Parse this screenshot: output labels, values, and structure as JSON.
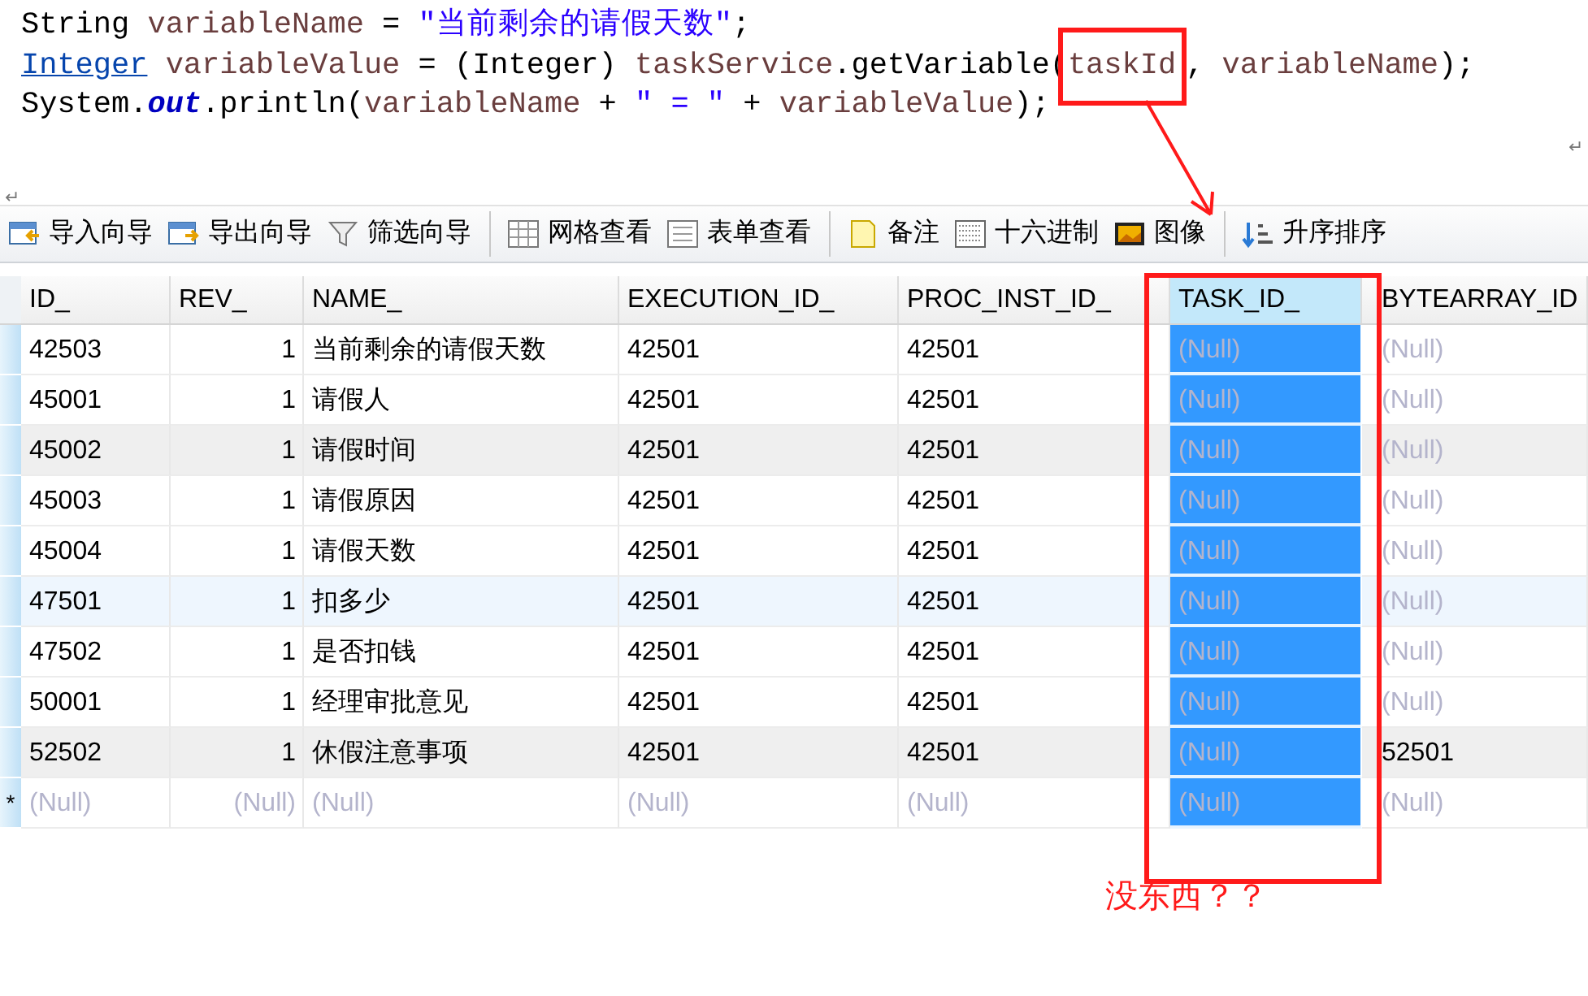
{
  "code_lines": [
    [
      {
        "text": "String ",
        "kind": "plain"
      },
      {
        "text": "variableName",
        "kind": "var"
      },
      {
        "text": " = ",
        "kind": "plain"
      },
      {
        "text": "\"当前剩余的请假天数\"",
        "kind": "string"
      },
      {
        "text": ";",
        "kind": "plain"
      }
    ],
    [
      {
        "text": "Integer",
        "kind": "link"
      },
      {
        "text": " variableValue",
        "kind": "var"
      },
      {
        "text": " = (Integer) ",
        "kind": "plain"
      },
      {
        "text": "taskService",
        "kind": "var"
      },
      {
        "text": ".getVariable(",
        "kind": "plain"
      },
      {
        "text": "taskId",
        "kind": "boxed"
      },
      {
        "text": ", ",
        "kind": "plain"
      },
      {
        "text": "variableName",
        "kind": "var"
      },
      {
        "text": ");",
        "kind": "plain"
      }
    ],
    [
      {
        "text": "System.",
        "kind": "plain"
      },
      {
        "text": "out",
        "kind": "field"
      },
      {
        "text": ".println(",
        "kind": "plain"
      },
      {
        "text": "variableName",
        "kind": "var"
      },
      {
        "text": " + ",
        "kind": "plain"
      },
      {
        "text": "\" = \"",
        "kind": "string"
      },
      {
        "text": " + ",
        "kind": "plain"
      },
      {
        "text": "variableValue",
        "kind": "var"
      },
      {
        "text": ");",
        "kind": "plain"
      }
    ]
  ],
  "paragraph_marks": [
    "↵",
    "↵"
  ],
  "toolbar": [
    {
      "label": "导入向导",
      "kind": "import"
    },
    {
      "label": "导出向导",
      "kind": "export"
    },
    {
      "label": "筛选向导",
      "kind": "filter",
      "separator_after": true
    },
    {
      "label": "网格查看",
      "kind": "grid"
    },
    {
      "label": "表单查看",
      "kind": "form",
      "separator_after": true
    },
    {
      "label": "备注",
      "kind": "note"
    },
    {
      "label": "十六进制",
      "kind": "hex"
    },
    {
      "label": "图像",
      "kind": "image",
      "separator_after": true
    },
    {
      "label": "升序排序",
      "kind": "sort"
    }
  ],
  "table": {
    "columns": [
      {
        "label": "ID_",
        "selected": false
      },
      {
        "label": "REV_",
        "selected": false
      },
      {
        "label": "NAME_",
        "selected": false
      },
      {
        "label": "EXECUTION_ID_",
        "selected": false
      },
      {
        "label": "PROC_INST_ID_",
        "selected": false
      },
      {
        "label": "TASK_ID_",
        "selected": true
      },
      {
        "label": "BYTEARRAY_ID",
        "selected": false
      }
    ],
    "rows": [
      {
        "striped": false,
        "hovered": false,
        "cells": [
          {
            "text": "42503",
            "null": false
          },
          {
            "text": "1",
            "null": false
          },
          {
            "text": "当前剩余的请假天数",
            "null": false
          },
          {
            "text": "42501",
            "null": false
          },
          {
            "text": "42501",
            "null": false
          },
          {
            "text": "(Null)",
            "null": true
          },
          {
            "text": "(Null)",
            "null": true
          }
        ]
      },
      {
        "striped": false,
        "hovered": false,
        "cells": [
          {
            "text": "45001",
            "null": false
          },
          {
            "text": "1",
            "null": false
          },
          {
            "text": "请假人",
            "null": false
          },
          {
            "text": "42501",
            "null": false
          },
          {
            "text": "42501",
            "null": false
          },
          {
            "text": "(Null)",
            "null": true
          },
          {
            "text": "(Null)",
            "null": true
          }
        ]
      },
      {
        "striped": true,
        "hovered": false,
        "cells": [
          {
            "text": "45002",
            "null": false
          },
          {
            "text": "1",
            "null": false
          },
          {
            "text": "请假时间",
            "null": false
          },
          {
            "text": "42501",
            "null": false
          },
          {
            "text": "42501",
            "null": false
          },
          {
            "text": "(Null)",
            "null": true
          },
          {
            "text": "(Null)",
            "null": true
          }
        ]
      },
      {
        "striped": false,
        "hovered": false,
        "cells": [
          {
            "text": "45003",
            "null": false
          },
          {
            "text": "1",
            "null": false
          },
          {
            "text": "请假原因",
            "null": false
          },
          {
            "text": "42501",
            "null": false
          },
          {
            "text": "42501",
            "null": false
          },
          {
            "text": "(Null)",
            "null": true
          },
          {
            "text": "(Null)",
            "null": true
          }
        ]
      },
      {
        "striped": false,
        "hovered": false,
        "cells": [
          {
            "text": "45004",
            "null": false
          },
          {
            "text": "1",
            "null": false
          },
          {
            "text": "请假天数",
            "null": false
          },
          {
            "text": "42501",
            "null": false
          },
          {
            "text": "42501",
            "null": false
          },
          {
            "text": "(Null)",
            "null": true
          },
          {
            "text": "(Null)",
            "null": true
          }
        ]
      },
      {
        "striped": false,
        "hovered": true,
        "cells": [
          {
            "text": "47501",
            "null": false
          },
          {
            "text": "1",
            "null": false
          },
          {
            "text": "扣多少",
            "null": false
          },
          {
            "text": "42501",
            "null": false
          },
          {
            "text": "42501",
            "null": false
          },
          {
            "text": "(Null)",
            "null": true
          },
          {
            "text": "(Null)",
            "null": true
          }
        ]
      },
      {
        "striped": false,
        "hovered": false,
        "cells": [
          {
            "text": "47502",
            "null": false
          },
          {
            "text": "1",
            "null": false
          },
          {
            "text": "是否扣钱",
            "null": false
          },
          {
            "text": "42501",
            "null": false
          },
          {
            "text": "42501",
            "null": false
          },
          {
            "text": "(Null)",
            "null": true
          },
          {
            "text": "(Null)",
            "null": true
          }
        ]
      },
      {
        "striped": false,
        "hovered": false,
        "cells": [
          {
            "text": "50001",
            "null": false
          },
          {
            "text": "1",
            "null": false
          },
          {
            "text": "经理审批意见",
            "null": false
          },
          {
            "text": "42501",
            "null": false
          },
          {
            "text": "42501",
            "null": false
          },
          {
            "text": "(Null)",
            "null": true
          },
          {
            "text": "(Null)",
            "null": true
          }
        ]
      },
      {
        "striped": true,
        "hovered": false,
        "cells": [
          {
            "text": "52502",
            "null": false
          },
          {
            "text": "1",
            "null": false
          },
          {
            "text": "休假注意事项",
            "null": false
          },
          {
            "text": "42501",
            "null": false
          },
          {
            "text": "42501",
            "null": false
          },
          {
            "text": "(Null)",
            "null": true
          },
          {
            "text": "52501",
            "null": false
          }
        ]
      },
      {
        "striped": false,
        "hovered": false,
        "marker": "*",
        "cells": [
          {
            "text": "(Null)",
            "null": true
          },
          {
            "text": "(Null)",
            "null": true
          },
          {
            "text": "(Null)",
            "null": true
          },
          {
            "text": "(Null)",
            "null": true
          },
          {
            "text": "(Null)",
            "null": true
          },
          {
            "text": "(Null)",
            "null": true
          },
          {
            "text": "(Null)",
            "null": true
          }
        ]
      }
    ]
  },
  "annotation": "没东西？？"
}
